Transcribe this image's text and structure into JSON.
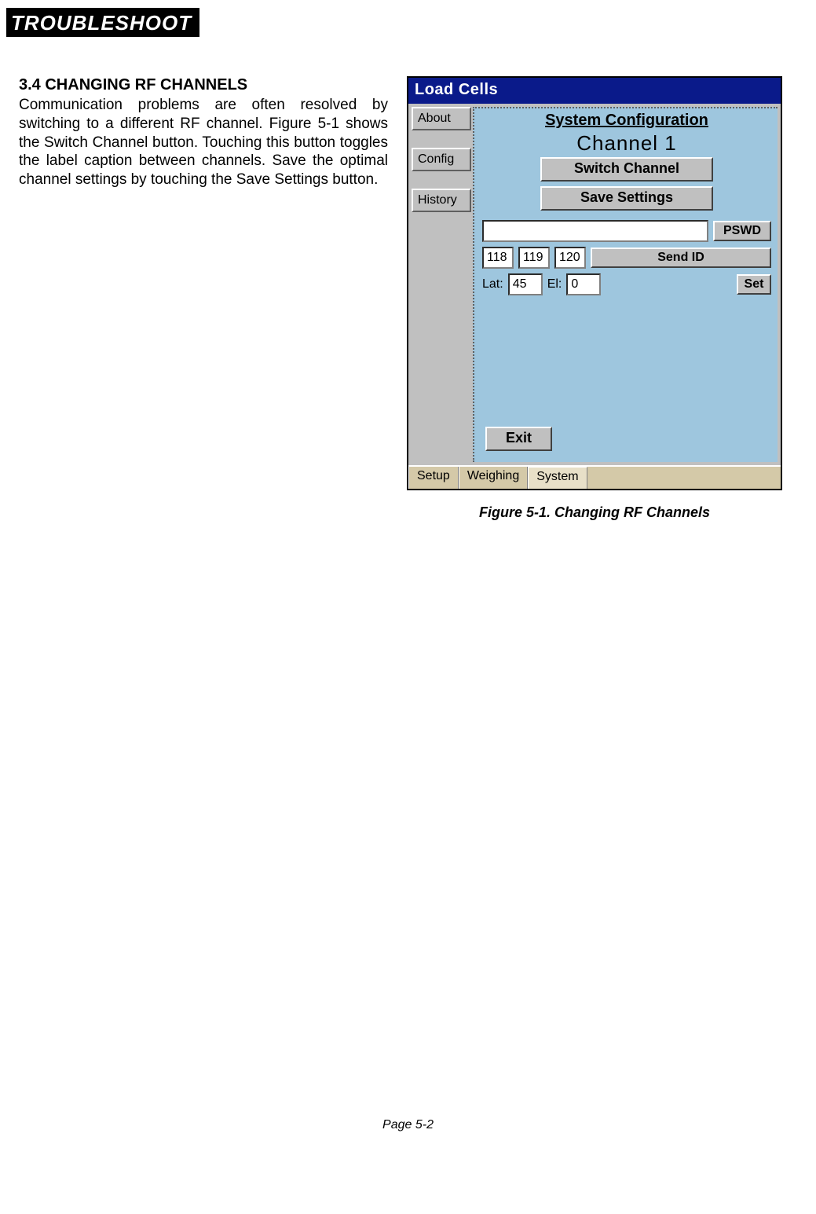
{
  "header": {
    "title": "Troubleshoot"
  },
  "section": {
    "heading": "3.4 CHANGING RF CHANNELS",
    "body": "Communication problems are often resolved by switching to a different RF channel. Figure 5-1 shows the Switch Channel button. Touching this button toggles the label caption between channels. Save the optimal channel settings by touching the Save Settings button."
  },
  "app": {
    "title": "Load Cells",
    "side_tabs": [
      "About",
      "Config",
      "History"
    ],
    "panel_title": "System Configuration",
    "channel_label": "Channel 1",
    "switch_btn": "Switch Channel",
    "save_btn": "Save Settings",
    "pswd_input": "",
    "pswd_btn": "PSWD",
    "id1": "118",
    "id2": "119",
    "id3": "120",
    "sendid_btn": "Send ID",
    "lat_label": "Lat:",
    "lat_value": "45",
    "el_label": "El:",
    "el_value": "0",
    "set_btn": "Set",
    "exit_btn": "Exit",
    "bottom_tabs": {
      "setup": "Setup",
      "weighing": "Weighing",
      "system": "System"
    }
  },
  "figure_caption": "Figure  5-1. Changing RF Channels",
  "footer": "Page 5-2"
}
